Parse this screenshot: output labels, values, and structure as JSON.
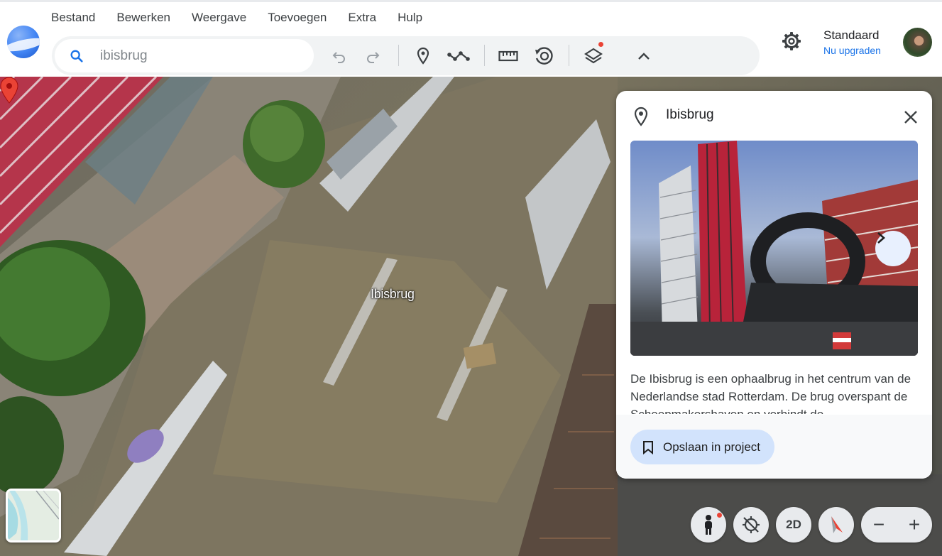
{
  "menu": [
    "Bestand",
    "Bewerken",
    "Weergave",
    "Toevoegen",
    "Extra",
    "Hulp"
  ],
  "search": {
    "value": "ibisbrug",
    "icon": "search-icon"
  },
  "toolbar": {
    "icons": [
      "undo-icon",
      "redo-icon",
      "placemark-icon",
      "path-icon",
      "ruler-icon",
      "historical-imagery-icon",
      "layers-icon",
      "chevron-up-icon"
    ]
  },
  "account": {
    "plan": "Standaard",
    "upgrade_label": "Nu upgraden"
  },
  "map": {
    "place_label": "Ibisbrug"
  },
  "panel": {
    "title": "Ibisbrug",
    "description": "De Ibisbrug is een ophaalbrug in het centrum van de Nederlandse stad Rotterdam. De brug overspant de Scheepmakershaven en verbindt de",
    "save_label": "Opslaan in project"
  },
  "controls": {
    "view_2d_label": "2D",
    "zoom_out": "−",
    "zoom_in": "+"
  },
  "colors": {
    "accent": "#1a73e8",
    "pin": "#ea4335",
    "save_bg": "#d2e3fc"
  }
}
